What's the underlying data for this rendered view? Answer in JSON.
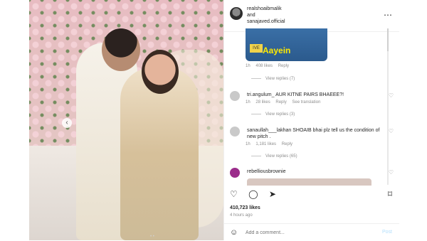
{
  "post": {
    "authors": {
      "line1": "realshoaibmalik",
      "line2": "and",
      "line3": "sanajaved.official"
    },
    "carousel": {
      "prev_icon": "chevron-left-icon"
    }
  },
  "comments": {
    "gif_comment": {
      "caption": "Aayein",
      "sticker": "IVE",
      "time": "1h",
      "likes": "408 likes",
      "reply": "Reply",
      "view_replies": "View replies (7)"
    },
    "items": [
      {
        "username": "tri.angulum_",
        "text": "AUR KITNE PAIRS BHAEEE?!",
        "time": "1h",
        "likes": "28 likes",
        "reply": "Reply",
        "translation": "See translation",
        "view_replies": "View replies (3)"
      },
      {
        "username": "sanaullah___lakhan",
        "text": "SHOAIB bhai plz tell us the condition of new pitch .",
        "time": "1h",
        "likes": "1,181 likes",
        "reply": "Reply",
        "view_replies": "View replies (65)"
      },
      {
        "username": "rebelliousbrownie",
        "text": ""
      }
    ]
  },
  "footer": {
    "likes": "410,723 likes",
    "ago": "4 hours ago",
    "add_placeholder": "Add a comment...",
    "post_label": "Post"
  },
  "icons": {
    "more": "more-horizontal-icon",
    "heart": "heart-icon",
    "comment": "comment-icon",
    "share": "share-icon",
    "bookmark": "bookmark-icon",
    "emoji": "emoji-icon"
  },
  "colors": {
    "post_disabled": "#b2dffc",
    "muted": "#8e8e8e"
  }
}
